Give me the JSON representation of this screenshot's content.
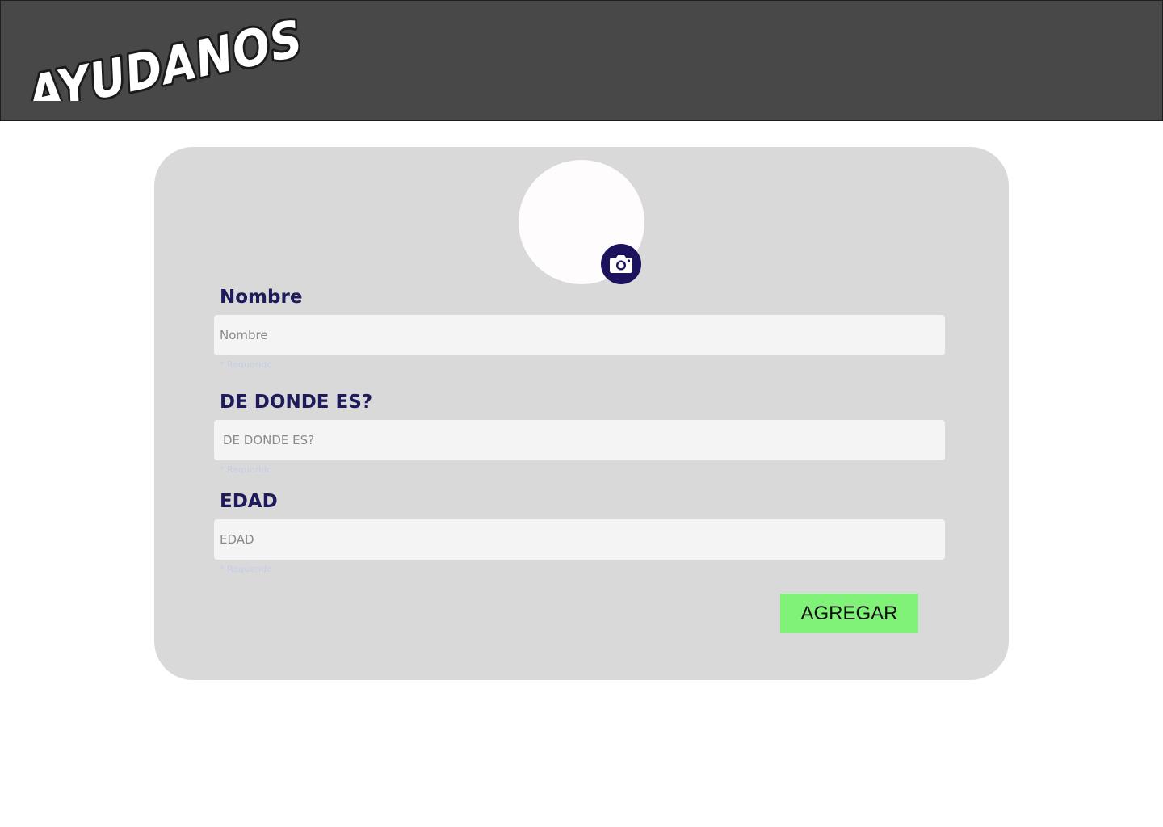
{
  "header": {
    "logo_text": "AYUDANOS"
  },
  "form": {
    "avatar": {
      "icon": "camera-icon"
    },
    "fields": [
      {
        "label": "Nombre",
        "placeholder": "Nombre",
        "hint": "* Requerido"
      },
      {
        "label": "DE DONDE ES?",
        "placeholder": "DE DONDE ES?",
        "hint": "* Requerido"
      },
      {
        "label": "EDAD",
        "placeholder": "EDAD",
        "hint": "* Requerido"
      }
    ],
    "submit_label": "AGREGAR"
  },
  "colors": {
    "header_bg": "#484848",
    "card_bg": "#d9d9d9",
    "label": "#1f1a5c",
    "accent_dark": "#1c135e",
    "submit_bg": "#80f278",
    "input_bg": "#f4f4f4"
  }
}
